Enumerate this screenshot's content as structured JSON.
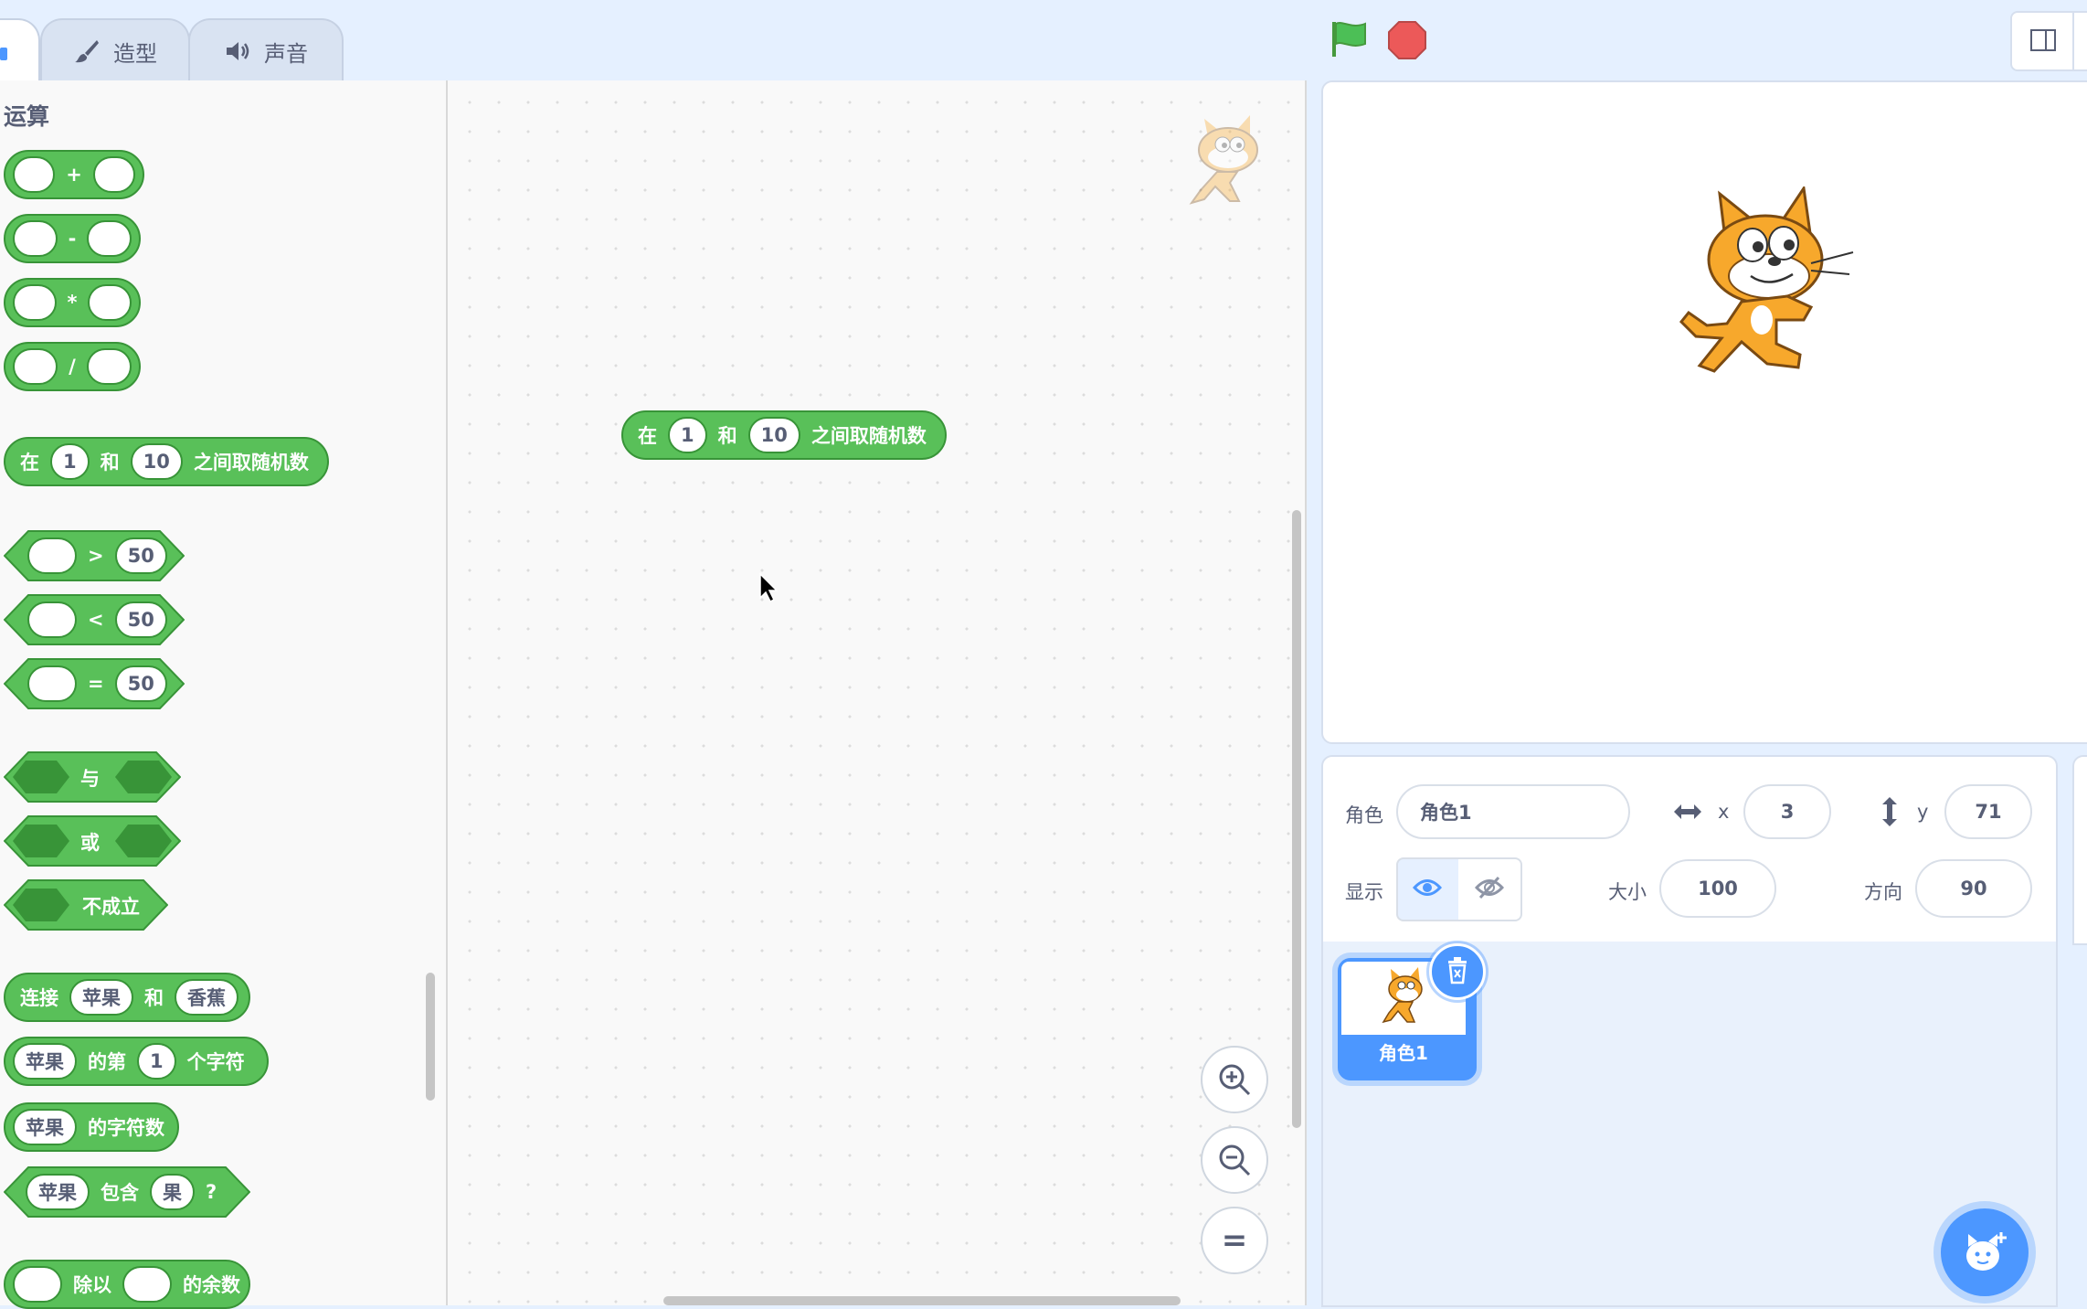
{
  "tabs": [
    {
      "label": "造型",
      "icon": "brush-icon"
    },
    {
      "label": "声音",
      "icon": "speaker-icon"
    }
  ],
  "palette": {
    "category": "运算",
    "blocks": {
      "add_op": "+",
      "sub_op": "-",
      "mul_op": "*",
      "div_op": "/",
      "random": {
        "pre": "在",
        "a": "1",
        "mid": "和",
        "b": "10",
        "post": "之间取随机数"
      },
      "gt": {
        "op": ">",
        "val": "50"
      },
      "lt": {
        "op": "<",
        "val": "50"
      },
      "eq": {
        "op": "=",
        "val": "50"
      },
      "and": "与",
      "or": "或",
      "not": "不成立",
      "join": {
        "pre": "连接",
        "a": "苹果",
        "mid": "和",
        "b": "香蕉"
      },
      "letter": {
        "a": "苹果",
        "mid": "的第",
        "b": "1",
        "post": "个字符"
      },
      "length": {
        "a": "苹果",
        "post": "的字符数"
      },
      "contains": {
        "a": "苹果",
        "mid": "包含",
        "b": "果",
        "post": "?"
      },
      "mod": {
        "mid": "除以",
        "post": "的余数"
      }
    }
  },
  "script_area": {
    "block": {
      "pre": "在",
      "a": "1",
      "mid": "和",
      "b": "10",
      "post": "之间取随机数"
    },
    "zoom_reset": "="
  },
  "sprite_info": {
    "sprite_label": "角色",
    "sprite_name": "角色1",
    "x_label": "x",
    "x_value": "3",
    "y_label": "y",
    "y_value": "71",
    "show_label": "显示",
    "size_label": "大小",
    "size_value": "100",
    "direction_label": "方向",
    "direction_value": "90"
  },
  "sprite_list": [
    {
      "name": "角色1",
      "selected": true
    }
  ],
  "colors": {
    "operator_block": "#59c059",
    "operator_border": "#389438",
    "accent": "#4c97ff",
    "flag": "#4cbf56",
    "stop": "#ec5959"
  }
}
